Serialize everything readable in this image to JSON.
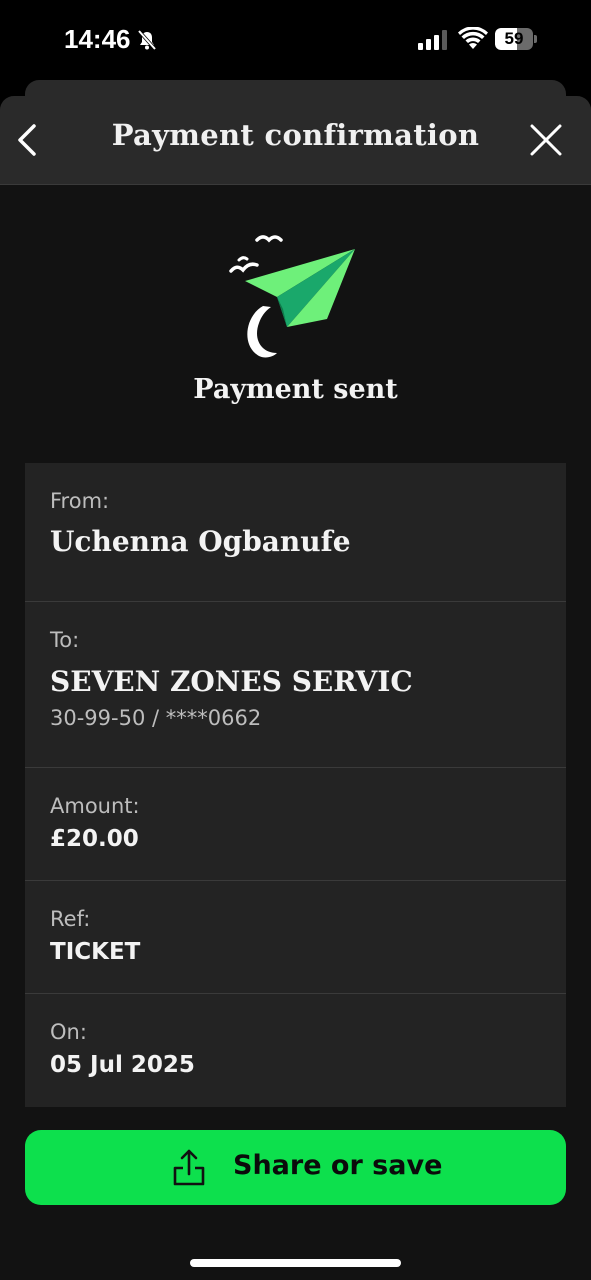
{
  "status_bar": {
    "time": "14:46",
    "battery_level": "59",
    "battery_fraction": 0.59
  },
  "header": {
    "title": "Payment confirmation"
  },
  "hero": {
    "text": "Payment sent",
    "icon": "paper-plane-icon"
  },
  "details": {
    "from_label": "From:",
    "from_value": "Uchenna Ogbanufe",
    "to_label": "To:",
    "to_value": "SEVEN ZONES SERVIC",
    "to_account": "30-99-50 / ****0662",
    "amount_label": "Amount:",
    "amount_value": "£20.00",
    "ref_label": "Ref:",
    "ref_value": "TICKET",
    "on_label": "On:",
    "on_value": "05 Jul 2025"
  },
  "share_button": {
    "label": "Share or save",
    "icon": "share-icon"
  },
  "colors": {
    "accent": "#0de04d",
    "plane_light": "#6ef07a",
    "plane_dark": "#1aa86b",
    "background": "#121212",
    "card": "#232323"
  }
}
